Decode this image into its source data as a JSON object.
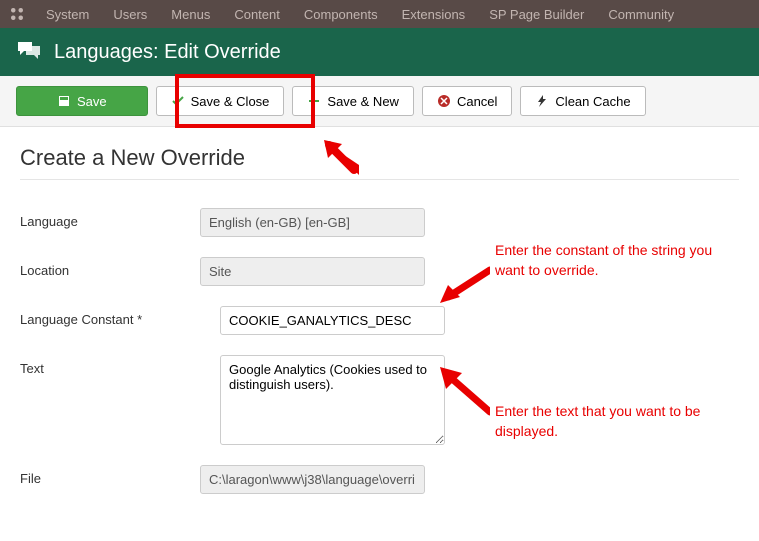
{
  "top_menu": {
    "items": [
      "System",
      "Users",
      "Menus",
      "Content",
      "Components",
      "Extensions",
      "SP Page Builder",
      "Community"
    ]
  },
  "header": {
    "title": "Languages: Edit Override"
  },
  "toolbar": {
    "save_label": "Save",
    "save_close_label": "Save & Close",
    "save_new_label": "Save & New",
    "cancel_label": "Cancel",
    "clean_cache_label": "Clean Cache"
  },
  "page": {
    "title": "Create a New Override"
  },
  "form": {
    "language": {
      "label": "Language",
      "value": "English (en-GB) [en-GB]"
    },
    "location": {
      "label": "Location",
      "value": "Site"
    },
    "constant": {
      "label": "Language Constant *",
      "value": "COOKIE_GANALYTICS_DESC"
    },
    "text": {
      "label": "Text",
      "value": "Google Analytics (Cookies used to distinguish users)."
    },
    "file": {
      "label": "File",
      "value": "C:\\laragon\\www\\j38\\language\\overri"
    }
  },
  "annotations": {
    "constant_hint": "Enter the constant of the string you want to override.",
    "text_hint": "Enter the text that you want to be displayed."
  }
}
